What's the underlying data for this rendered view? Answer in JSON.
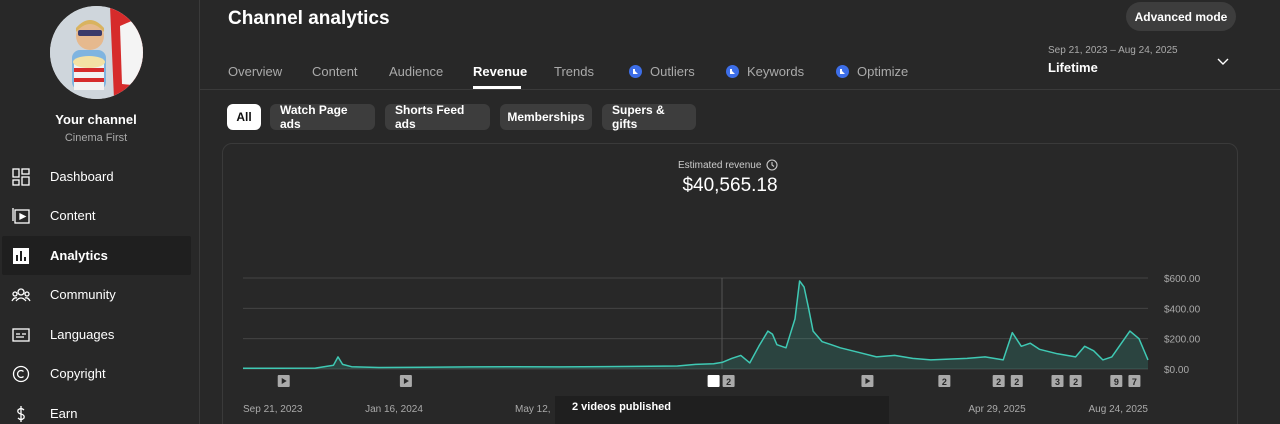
{
  "sidebar": {
    "channel_name": "Your channel",
    "channel_handle": "Cinema First",
    "items": [
      {
        "label": "Dashboard",
        "icon": "dashboard-icon"
      },
      {
        "label": "Content",
        "icon": "content-icon"
      },
      {
        "label": "Analytics",
        "icon": "analytics-icon",
        "active": true
      },
      {
        "label": "Community",
        "icon": "community-icon"
      },
      {
        "label": "Languages",
        "icon": "languages-icon"
      },
      {
        "label": "Copyright",
        "icon": "copyright-icon"
      },
      {
        "label": "Earn",
        "icon": "earn-icon"
      }
    ]
  },
  "header": {
    "title": "Channel analytics",
    "advanced_mode": "Advanced mode",
    "date_range": "Sep 21, 2023 – Aug 24, 2025",
    "date_label": "Lifetime"
  },
  "tabs": [
    {
      "label": "Overview"
    },
    {
      "label": "Content"
    },
    {
      "label": "Audience"
    },
    {
      "label": "Revenue",
      "active": true
    },
    {
      "label": "Trends"
    },
    {
      "label": "Outliers",
      "icon": "lab-icon"
    },
    {
      "label": "Keywords",
      "icon": "lab-icon"
    },
    {
      "label": "Optimize",
      "icon": "lab-icon"
    }
  ],
  "chips": [
    {
      "label": "All",
      "active": true
    },
    {
      "label": "Watch Page ads"
    },
    {
      "label": "Shorts Feed ads"
    },
    {
      "label": "Memberships"
    },
    {
      "label": "Supers & gifts"
    }
  ],
  "metric": {
    "label": "Estimated revenue",
    "value": "$40,565.18"
  },
  "tooltip": {
    "text": "2 videos published"
  },
  "colors": {
    "accent_line": "#3fc9b4",
    "background": "#282828",
    "lab_icon": "#3d6ee8"
  },
  "chart_data": {
    "type": "area",
    "title": "Estimated revenue",
    "x_labels": [
      "Sep 21, 2023",
      "Jan 16, 2024",
      "May 12,",
      "Apr 29, 2025",
      "Aug 24, 2025"
    ],
    "y_ticks": [
      "$600.00",
      "$400.00",
      "$200.00",
      "$0.00"
    ],
    "ylim": [
      0,
      600
    ],
    "series": [
      {
        "name": "Estimated revenue",
        "x": [
          0,
          0.04,
          0.08,
          0.1,
          0.105,
          0.11,
          0.12,
          0.15,
          0.2,
          0.25,
          0.3,
          0.35,
          0.4,
          0.45,
          0.48,
          0.5,
          0.52,
          0.53,
          0.54,
          0.55,
          0.56,
          0.57,
          0.58,
          0.585,
          0.59,
          0.6,
          0.61,
          0.615,
          0.62,
          0.625,
          0.63,
          0.64,
          0.65,
          0.66,
          0.68,
          0.7,
          0.72,
          0.74,
          0.76,
          0.78,
          0.8,
          0.82,
          0.84,
          0.85,
          0.86,
          0.87,
          0.88,
          0.9,
          0.92,
          0.93,
          0.94,
          0.95,
          0.96,
          0.98,
          0.99,
          1.0
        ],
        "y": [
          5,
          5,
          6,
          25,
          80,
          30,
          15,
          10,
          12,
          14,
          15,
          14,
          16,
          18,
          20,
          30,
          35,
          45,
          70,
          90,
          40,
          150,
          250,
          230,
          160,
          140,
          330,
          580,
          540,
          400,
          250,
          180,
          160,
          140,
          110,
          80,
          90,
          70,
          60,
          65,
          70,
          80,
          60,
          240,
          150,
          170,
          130,
          100,
          80,
          150,
          120,
          60,
          80,
          250,
          200,
          60
        ]
      }
    ],
    "markers": [
      {
        "x": 0.045,
        "label": ""
      },
      {
        "x": 0.18,
        "label": ""
      },
      {
        "x": 0.52,
        "label": "2"
      },
      {
        "x": 0.69,
        "label": ""
      },
      {
        "x": 0.775,
        "label": "2"
      },
      {
        "x": 0.835,
        "label": "2"
      },
      {
        "x": 0.855,
        "label": "2"
      },
      {
        "x": 0.9,
        "label": "3"
      },
      {
        "x": 0.92,
        "label": "2"
      },
      {
        "x": 0.965,
        "label": "9"
      },
      {
        "x": 0.985,
        "label": "7"
      }
    ],
    "grid": true
  }
}
